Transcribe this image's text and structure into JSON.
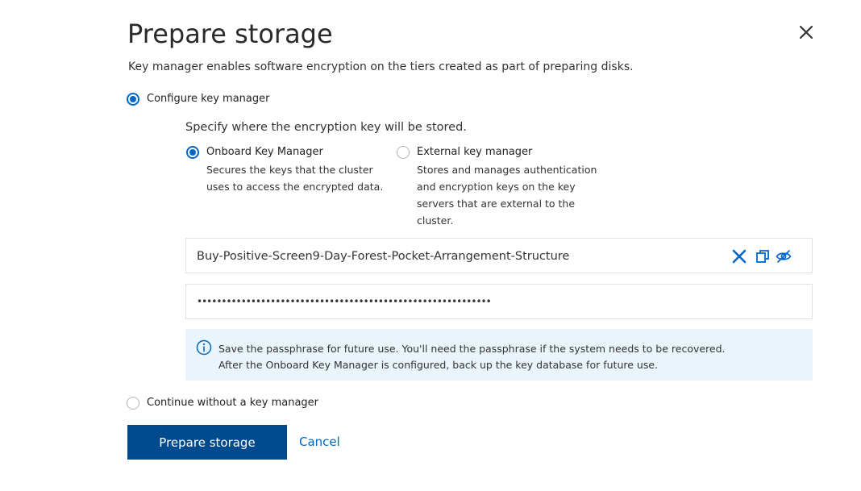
{
  "dialog": {
    "title": "Prepare storage",
    "subtitle": "Key manager enables software encryption on the tiers created as part of preparing disks."
  },
  "options": {
    "configure_key_manager": {
      "label": "Configure key manager",
      "selected": true
    },
    "continue_without": {
      "label": "Continue without a key manager",
      "selected": false
    }
  },
  "key_location": {
    "prompt": "Specify where the encryption key will be stored.",
    "onboard": {
      "label": "Onboard Key Manager",
      "desc_line1": "Secures the keys that the cluster",
      "desc_line2": "uses to access the encrypted data.",
      "selected": true
    },
    "external": {
      "label": "External key manager",
      "desc_line1": "Stores and manages authentication",
      "desc_line2": "and encryption keys on the key",
      "desc_line3": "servers that are external to the",
      "desc_line4": "cluster.",
      "selected": false
    }
  },
  "passphrase": {
    "value": "Buy-Positive-Screen9-Day-Forest-Pocket-Arrangement-Structure",
    "icons": [
      "clear-icon",
      "copy-icon",
      "hide-password-icon"
    ]
  },
  "confirm_passphrase": {
    "masked_value": "••••••••••••••••••••••••••••••••••••••••••••••••••••••••••••"
  },
  "info_banner": {
    "icon": "info-icon",
    "line1": "Save the passphrase for future use. You'll need the passphrase if the system needs to be recovered.",
    "line2": "After the Onboard Key Manager is configured, back up the key database for future use."
  },
  "actions": {
    "primary_label": "Prepare storage",
    "cancel_label": "Cancel"
  },
  "colors": {
    "accent": "#0067c5",
    "primary_button": "#004b8d",
    "info_background": "#e9f5fb",
    "icon_blue": "#0067c5"
  }
}
